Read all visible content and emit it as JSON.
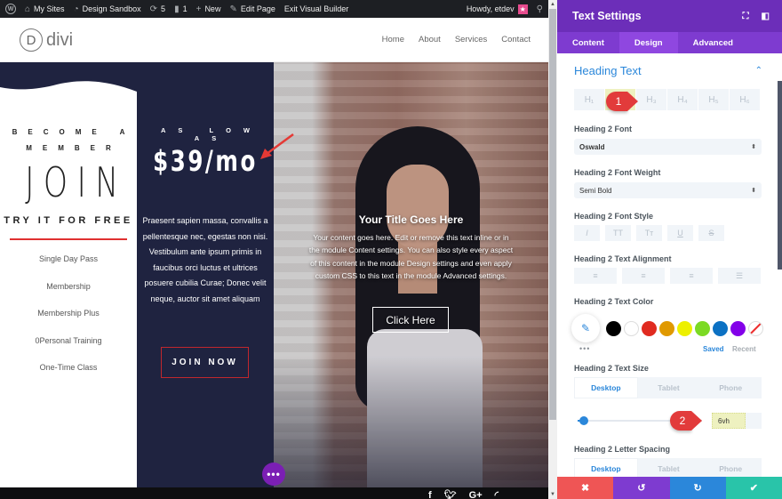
{
  "admin_bar": {
    "items": [
      {
        "icon": "wordpress-logo-icon",
        "label": ""
      },
      {
        "icon": "my-sites-icon",
        "label": "My Sites"
      },
      {
        "icon": "dashboard-icon",
        "label": "Design Sandbox"
      },
      {
        "icon": "updates-icon",
        "label": "5"
      },
      {
        "icon": "comments-icon",
        "label": "1"
      },
      {
        "icon": "plus-icon",
        "label": "New"
      },
      {
        "icon": "pencil-icon",
        "label": "Edit Page"
      },
      {
        "icon": "",
        "label": "Exit Visual Builder"
      }
    ],
    "howdy": "Howdy, etdev"
  },
  "site": {
    "logo_letter": "D",
    "logo_text": "divi",
    "nav": [
      "Home",
      "About",
      "Services",
      "Contact"
    ]
  },
  "membership": {
    "eyebrow": "BECOME A MEMBER",
    "headline": "JOIN",
    "cta": "TRY IT FOR FREE",
    "services": [
      "Single Day Pass",
      "Membership",
      "Membership Plus",
      "0Personal Training",
      "One-Time Class"
    ]
  },
  "pricing": {
    "eyebrow": "AS LOW AS",
    "price": "$39/mo",
    "body": "Praesent sapien massa, convallis a pellentesque nec, egestas non nisi. Vestibulum ante ipsum primis in faucibus orci luctus et ultrices posuere cubilia Curae; Donec velit neque, auctor sit amet aliquam",
    "button": "JOIN NOW"
  },
  "cta_module": {
    "title": "Your Title Goes Here",
    "body": "Your content goes here. Edit or remove this text inline or in the module Content settings. You can also style every aspect of this content in the module Design settings and even apply custom CSS to this text in the module Advanced settings.",
    "button": "Click Here"
  },
  "footer": {
    "social": [
      "f",
      "t",
      "G+",
      "rss"
    ]
  },
  "builder": {
    "more_button": "•••"
  },
  "panel": {
    "title": "Text Settings",
    "tabs": [
      "Content",
      "Design",
      "Advanced"
    ],
    "active_tab": "Design",
    "section_title": "Heading Text",
    "heading_levels": [
      "H1",
      "H2",
      "H3",
      "H4",
      "H5",
      "H6"
    ],
    "heading_level_labels": [
      "H₁",
      "H₂",
      "H₃",
      "H₄",
      "H₅",
      "H₆"
    ],
    "active_heading": "H2",
    "font_label": "Heading 2 Font",
    "font_value": "Oswald",
    "weight_label": "Heading 2 Font Weight",
    "weight_value": "Semi Bold",
    "style_label": "Heading 2 Font Style",
    "style_buttons": [
      "I",
      "TT",
      "Tт",
      "U",
      "S"
    ],
    "alignment_label": "Heading 2 Text Alignment",
    "alignment_buttons": [
      "left",
      "center",
      "right",
      "justify"
    ],
    "color_label": "Heading 2 Text Color",
    "swatches": [
      "#000000",
      "#ffffff",
      "#e02b20",
      "#e09900",
      "#edf000",
      "#7cda24",
      "#0c71c3",
      "#8300e9"
    ],
    "saved_label": "Saved",
    "recent_label": "Recent",
    "size_label": "Heading 2 Text Size",
    "device_tabs": [
      "Desktop",
      "Tablet",
      "Phone"
    ],
    "size_value": "6vh",
    "size_slider_fraction": 0.05,
    "letter_spacing_label": "Heading 2 Letter Spacing",
    "more_dots": "•••"
  },
  "annotations": {
    "step1": "1",
    "step2": "2"
  },
  "actions": {
    "colors": [
      "#ef5555",
      "#7e3bd0",
      "#2b87da",
      "#29c4a9"
    ],
    "icons": [
      "✖",
      "↺",
      "↻",
      "✔"
    ]
  }
}
